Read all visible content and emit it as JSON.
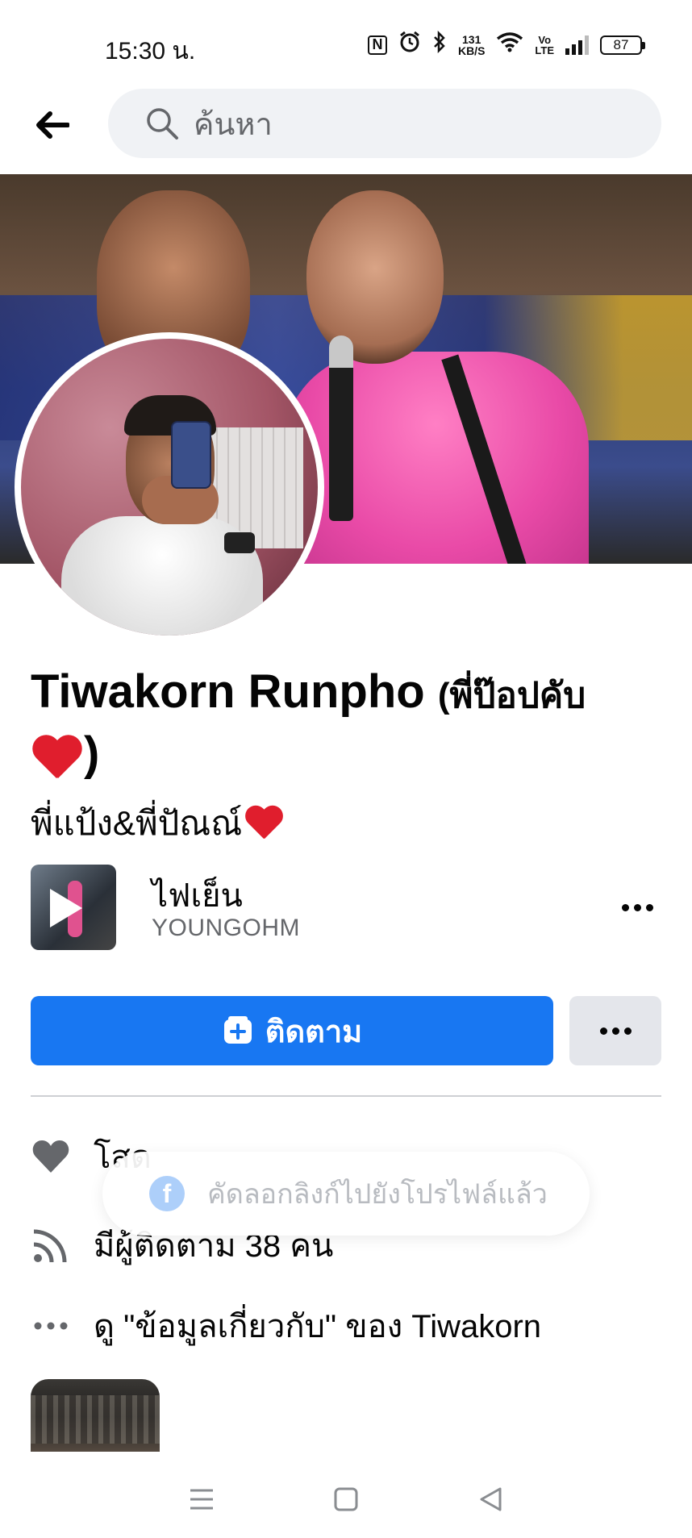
{
  "status_bar": {
    "time": "15:30 น.",
    "nfc_label": "N",
    "alarm_icon": "alarm-icon",
    "bluetooth_icon": "bluetooth-icon",
    "speed_value": "131",
    "speed_unit": "KB/S",
    "volte_top": "Vo",
    "volte_bottom": "LTE",
    "battery": "87"
  },
  "header": {
    "back_icon": "back-arrow-icon",
    "search_placeholder": "ค้นหา"
  },
  "profile": {
    "name": "Tiwakorn Runpho",
    "nickname_open": "(พี่ป๊อปคับ",
    "nickname_close": ")",
    "bio": "พี่แป้ง&พี่ปัณณ์"
  },
  "music": {
    "title": "ไฟเย็น",
    "artist": "YOUNGOHM"
  },
  "actions": {
    "follow_label": "ติดตาม"
  },
  "details": {
    "relationship": "โสด",
    "followers": "มีผู้ติดตาม 38 คน",
    "about": "ดู \"ข้อมูลเกี่ยวกับ\" ของ Tiwakorn"
  },
  "toast": {
    "message": "คัดลอกลิงก์ไปยังโปรไฟล์แล้ว",
    "icon_letter": "f"
  },
  "colors": {
    "primary": "#1877f2",
    "secondary_button": "#e4e6eb",
    "search_bg": "#f0f2f5",
    "muted_text": "#65676b",
    "heart": "#e01e2d"
  }
}
